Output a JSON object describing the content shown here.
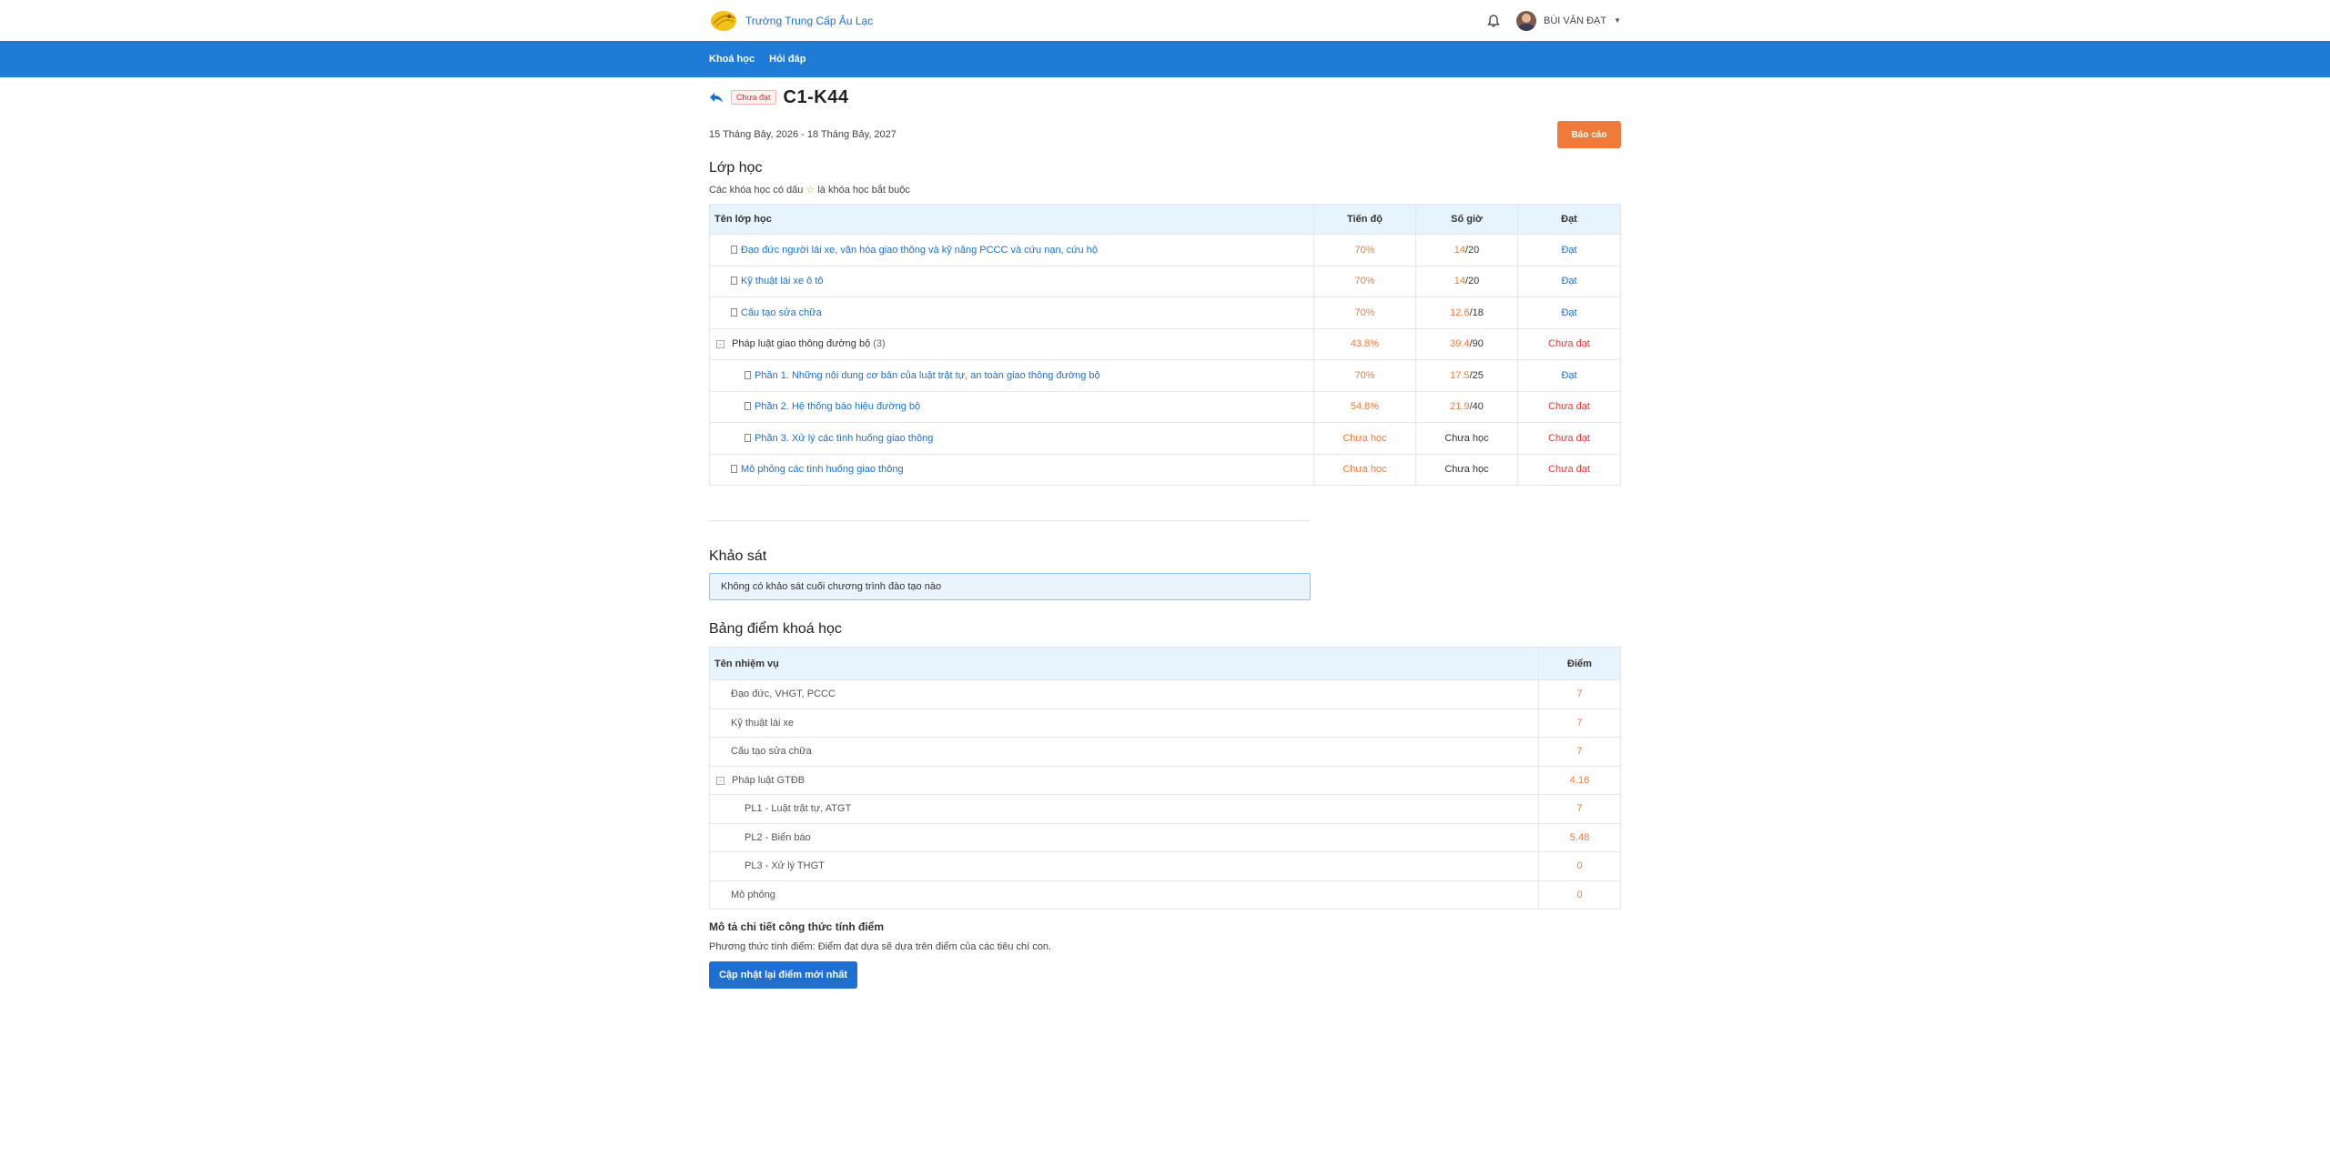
{
  "header": {
    "school_name": "Trường Trung Cấp Âu Lạc",
    "user_name": "BÙI VĂN ĐẠT"
  },
  "nav": {
    "items": [
      {
        "label": "Khoá học"
      },
      {
        "label": "Hỏi đáp"
      }
    ]
  },
  "course": {
    "status": "Chưa đạt",
    "title": "C1-K44",
    "date_range": "15 Tháng Bảy, 2026 - 18 Tháng Bảy, 2027",
    "report_label": "Báo cáo"
  },
  "classes": {
    "title": "Lớp học",
    "note_before": "Các khóa học có dấu",
    "note_after": "là khóa học bắt buộc",
    "columns": [
      "Tên lớp học",
      "Tiến độ",
      "Số giờ",
      "Đạt"
    ],
    "rows": [
      {
        "name": "Đạo đức người lái xe, văn hóa giao thông và kỹ năng PCCC và cứu nạn, cứu hộ",
        "progress": "70%",
        "hours_done": "14",
        "hours_total": "/20",
        "pass": "Đạt"
      },
      {
        "name": "Kỹ thuật lái xe ô tô",
        "progress": "70%",
        "hours_done": "14",
        "hours_total": "/20",
        "pass": "Đạt"
      },
      {
        "name": "Cấu tạo sửa chữa",
        "progress": "70%",
        "hours_done": "12.6",
        "hours_total": "/18",
        "pass": "Đạt"
      },
      {
        "name": "Pháp luật giao thông đường bộ",
        "count": "(3)",
        "toggle": "-",
        "progress": "43.8%",
        "hours_done": "39.4",
        "hours_total": "/90",
        "pass": "Chưa đạt"
      },
      {
        "name": "Phần 1. Những nội dung cơ bản của luật trật tự, an toàn giao thông đường bộ",
        "progress": "70%",
        "hours_done": "17.5",
        "hours_total": "/25",
        "pass": "Đạt"
      },
      {
        "name": "Phần 2. Hệ thống báo hiệu đường bộ",
        "progress": "54.8%",
        "hours_done": "21.9",
        "hours_total": "/40",
        "pass": "Chưa đạt"
      },
      {
        "name": "Phần 3. Xử lý các tình huống giao thông",
        "progress": "Chưa học",
        "hours_text": "Chưa học",
        "pass": "Chưa đạt"
      },
      {
        "name": "Mô phỏng các tình huống giao thông",
        "progress": "Chưa học",
        "hours_text": "Chưa học",
        "pass": "Chưa đạt"
      }
    ]
  },
  "survey": {
    "title": "Khảo sát",
    "message": "Không có khảo sát cuối chương trình đào tạo nào"
  },
  "scores": {
    "title": "Bảng điểm khoá học",
    "columns": [
      "Tên nhiệm vụ",
      "Điểm"
    ],
    "rows": [
      {
        "task": "Đạo đức, VHGT, PCCC",
        "score": "7"
      },
      {
        "task": "Kỹ thuật lái xe",
        "score": "7"
      },
      {
        "task": "Cấu tạo sửa chữa",
        "score": "7"
      },
      {
        "task": "Pháp luật GTĐB",
        "score": "4.16",
        "toggle": "-"
      },
      {
        "task": "PL1 - Luật trật tự, ATGT",
        "score": "7"
      },
      {
        "task": "PL2 - Biển báo",
        "score": "5.48"
      },
      {
        "task": "PL3 - Xử lý THGT",
        "score": "0"
      },
      {
        "task": "Mô phỏng",
        "score": "0"
      }
    ]
  },
  "formula": {
    "title": "Mô tả chi tiết công thức tính điểm",
    "description": "Phương thức tính điểm: Điểm đạt dựa sẽ dựa trên điểm của các tiêu chí con.",
    "update_label": "Cập nhật lại điểm mới nhất"
  },
  "colors": {
    "brand_blue": "#1e7bd6",
    "accent_orange": "#f07a39",
    "fail_red": "#e23b3b",
    "header_bg": "#e8f4fd"
  },
  "icons": [
    "school-logo-icon",
    "bell-icon",
    "avatar",
    "back-arrow-icon",
    "star-icon",
    "document-icon",
    "collapse-toggle-icon",
    "caret-down-icon"
  ]
}
